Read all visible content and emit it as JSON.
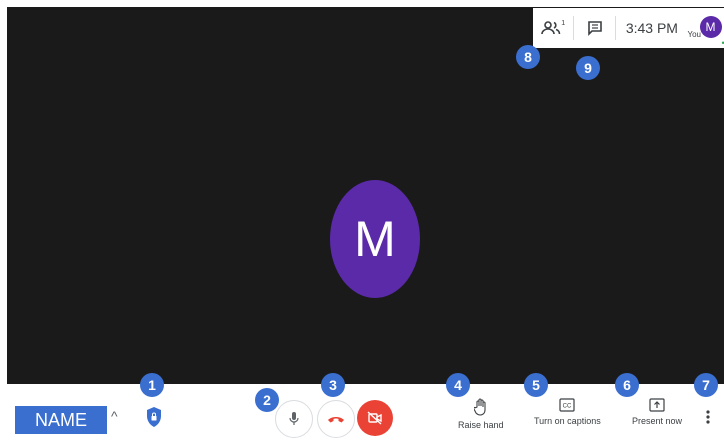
{
  "colors": {
    "accent_blue": "#3a6fd0",
    "avatar_purple": "#5a2aa8",
    "danger_red": "#ea4335",
    "stage_bg": "#1a1a1a"
  },
  "participant": {
    "initial": "M"
  },
  "top_bar": {
    "people_icon": "people-icon",
    "people_count": "1",
    "chat_icon": "chat-icon",
    "time": "3:43 PM",
    "self_label": "You",
    "self_initial": "M"
  },
  "bottom_bar": {
    "name": "NAME",
    "raise_hand_label": "Raise hand",
    "captions_label": "Turn on captions",
    "present_label": "Present now"
  },
  "annotations": [
    "1",
    "2",
    "3",
    "4",
    "5",
    "6",
    "7",
    "8",
    "9"
  ]
}
